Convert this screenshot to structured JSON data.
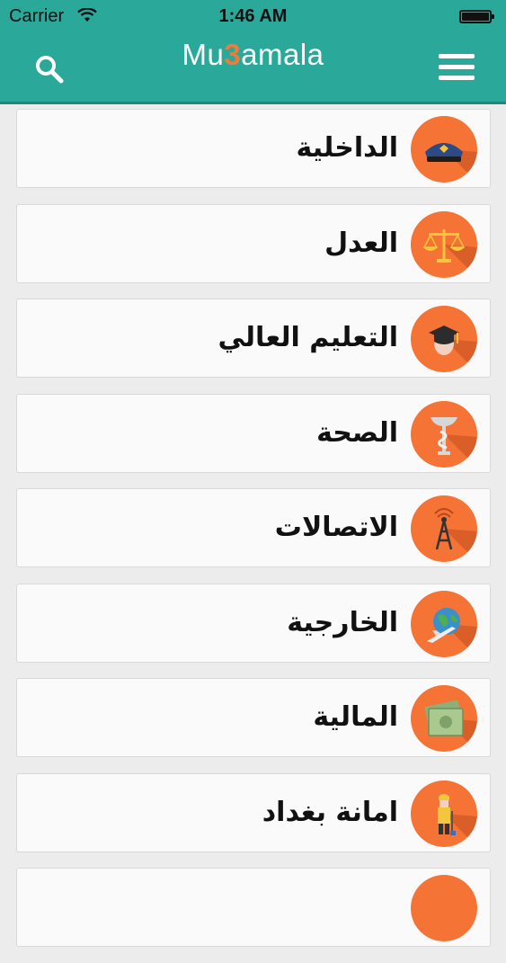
{
  "status_bar": {
    "carrier": "Carrier",
    "time": "1:46 AM"
  },
  "header": {
    "logo_pre": "Mu",
    "logo_mark": "3",
    "logo_post": "amala",
    "accent": "#2aa89a",
    "brand_orange": "#f47335"
  },
  "ministries": [
    {
      "label": "الداخلية",
      "icon": "police-cap-icon"
    },
    {
      "label": "العدل",
      "icon": "scales-icon"
    },
    {
      "label": "التعليم العالي",
      "icon": "graduate-icon"
    },
    {
      "label": "الصحة",
      "icon": "medical-symbol-icon"
    },
    {
      "label": "الاتصالات",
      "icon": "antenna-tower-icon"
    },
    {
      "label": "الخارجية",
      "icon": "globe-plane-icon"
    },
    {
      "label": "المالية",
      "icon": "money-icon"
    },
    {
      "label": "امانة بغداد",
      "icon": "worker-icon"
    }
  ]
}
